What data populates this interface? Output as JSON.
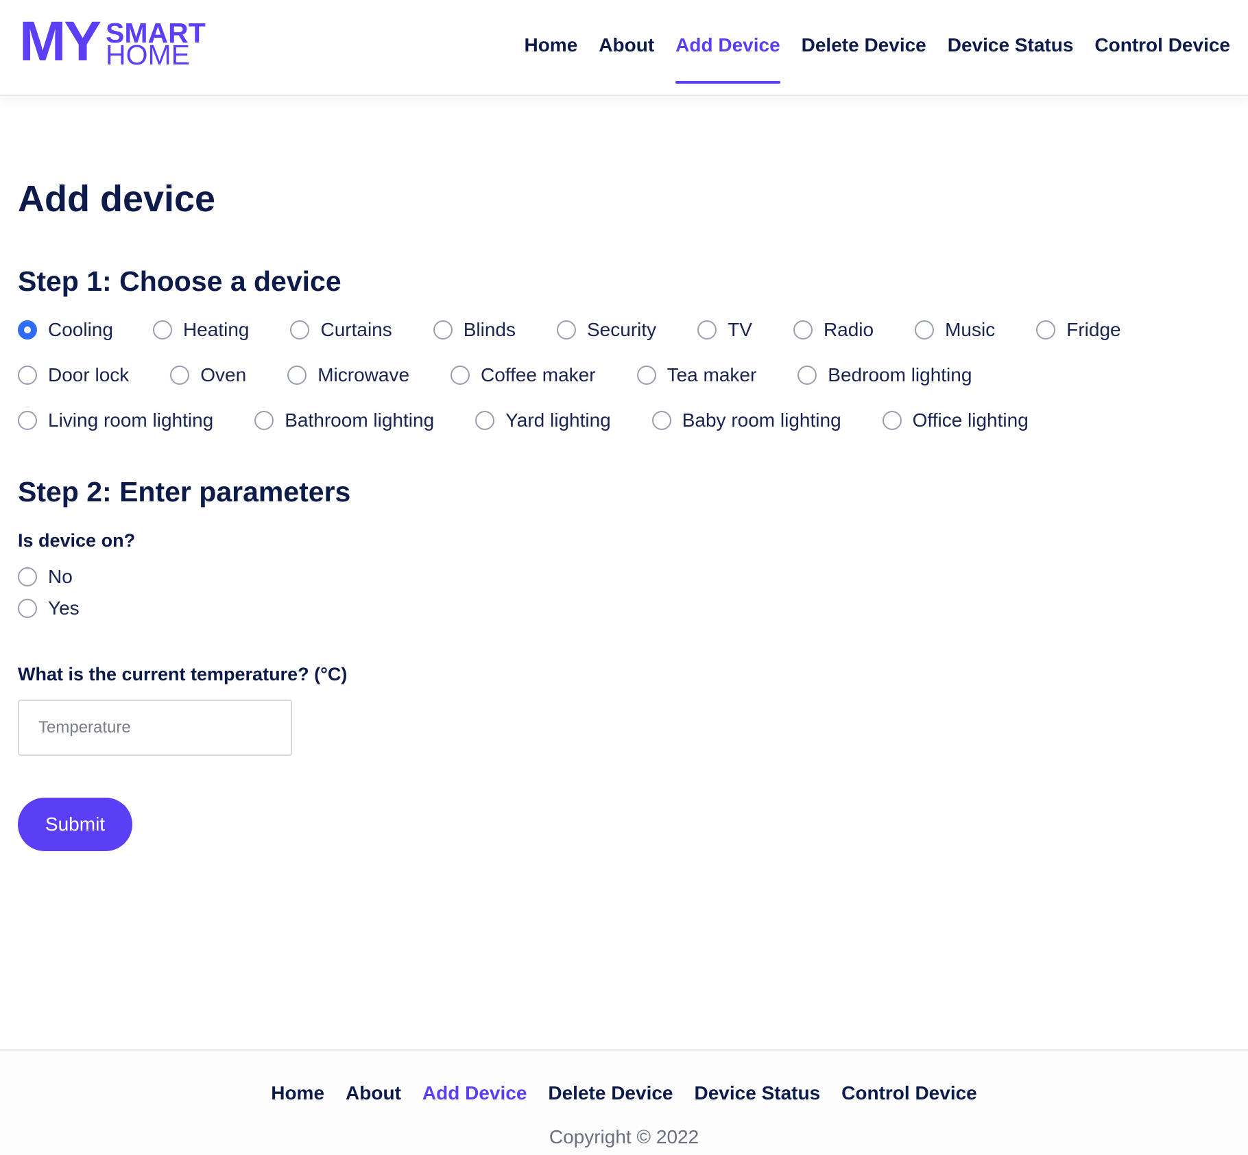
{
  "logo": {
    "my": "MY",
    "smart": "SMART",
    "home": "HOME"
  },
  "nav": {
    "items": [
      "Home",
      "About",
      "Add Device",
      "Delete Device",
      "Device Status",
      "Control Device"
    ],
    "active": "Add Device"
  },
  "page": {
    "title": "Add device",
    "step1_title": "Step 1: Choose a device",
    "step2_title": "Step 2: Enter parameters"
  },
  "devices": {
    "selected": "Cooling",
    "rows": [
      [
        "Cooling",
        "Heating",
        "Curtains",
        "Blinds",
        "Security",
        "TV",
        "Radio",
        "Music",
        "Fridge"
      ],
      [
        "Door lock",
        "Oven",
        "Microwave",
        "Coffee maker",
        "Tea maker",
        "Bedroom lighting"
      ],
      [
        "Living room lighting",
        "Bathroom lighting",
        "Yard lighting",
        "Baby room lighting",
        "Office lighting"
      ]
    ]
  },
  "params": {
    "device_on_label": "Is device on?",
    "on_options": [
      "No",
      "Yes"
    ],
    "temperature_label": "What is the current temperature? (°C)",
    "temperature_placeholder": "Temperature",
    "temperature_value": ""
  },
  "submit_label": "Submit",
  "footer": {
    "items": [
      "Home",
      "About",
      "Add Device",
      "Delete Device",
      "Device Status",
      "Control Device"
    ],
    "active": "Add Device",
    "copyright": "Copyright © 2022"
  },
  "colors": {
    "accent": "#5a3ff5",
    "text": "#0d1b4a",
    "radio_checked": "#2f6cf6",
    "muted": "#6b7080"
  }
}
